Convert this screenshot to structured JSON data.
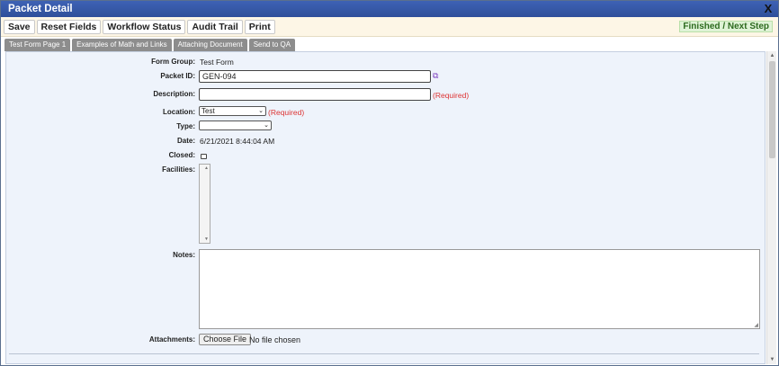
{
  "window": {
    "title": "Packet Detail"
  },
  "toolbar": {
    "save": "Save",
    "reset": "Reset Fields",
    "workflow": "Workflow Status",
    "audit": "Audit Trail",
    "print": "Print",
    "finish": "Finished / Next Step"
  },
  "tabs": [
    "Test Form Page 1",
    "Examples of Math and Links",
    "Attaching Document",
    "Send to QA"
  ],
  "form": {
    "form_group_label": "Form Group:",
    "form_group_value": "Test Form",
    "packet_id_label": "Packet ID:",
    "packet_id_value": "GEN-094",
    "description_label": "Description:",
    "description_value": "",
    "required_text": "(Required)",
    "location_label": "Location:",
    "location_value": "Test",
    "type_label": "Type:",
    "type_value": "",
    "date_label": "Date:",
    "date_value": "6/21/2021 8:44:04 AM",
    "closed_label": "Closed:",
    "closed_checked": false,
    "facilities_label": "Facilities:",
    "notes_label": "Notes:",
    "attachments_label": "Attachments:",
    "choose_file": "Choose File",
    "no_file": "No file chosen"
  },
  "icons": {
    "close": "close-icon",
    "link": "link-icon",
    "chevron": "chevron-down-icon"
  }
}
